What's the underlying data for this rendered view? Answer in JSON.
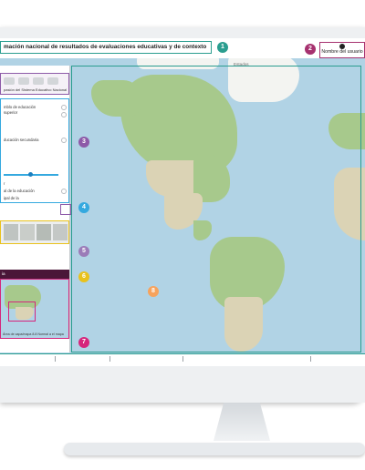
{
  "app": {
    "title": "mación nacional de resultados de evaluaciones educativas y de contexto",
    "user_name": "Nombre del usuario"
  },
  "badges": [
    "1",
    "2",
    "3",
    "4",
    "5",
    "6",
    "7",
    "8"
  ],
  "tools_panel": {
    "caption": "pasión del Sistema Educativo Nacional"
  },
  "layers_panel": {
    "items": [
      "mblo de educación",
      "superior",
      "ducación secundaria",
      "r",
      "al de la educación",
      "ipal de la"
    ]
  },
  "minimap_panel": {
    "title": "ia",
    "caption": "Área de capa/mapa 8.8   Normal a el mapa"
  },
  "map": {
    "hint": "Estados"
  },
  "colors": {
    "teal": "#2a9d8f",
    "purple": "#8d5aa8",
    "blue": "#35a9df",
    "yellow": "#e9c21c",
    "magenta": "#d6267c",
    "orange": "#f6a35d",
    "maroon": "#a6316f"
  },
  "icons": [
    "user-icon",
    "map-tool-icon",
    "zoom-icon",
    "compare-icon",
    "locate-icon"
  ]
}
